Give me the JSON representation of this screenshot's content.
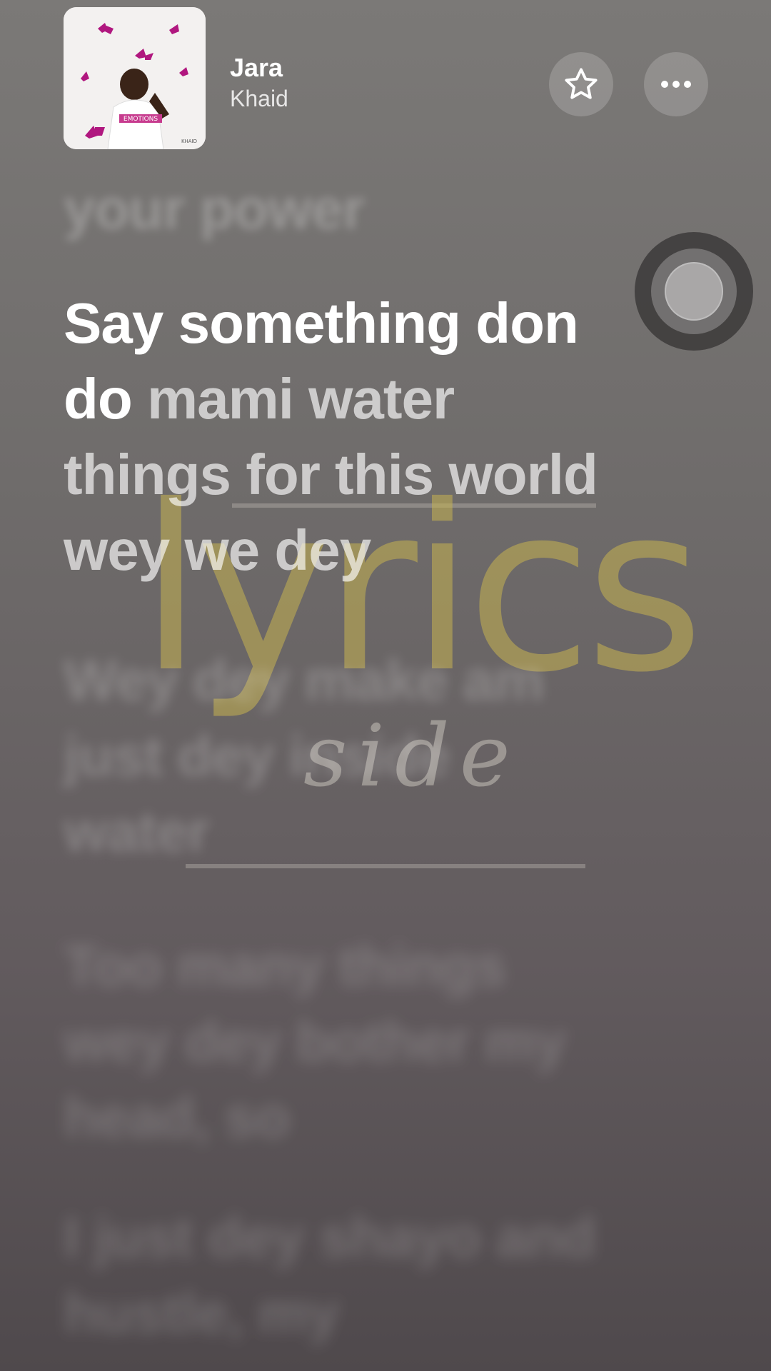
{
  "now_playing": {
    "title": "Jara",
    "artist": "Khaid",
    "album_art_text": "EMOTIONS",
    "album_art_credit": "KHAID",
    "favorite_icon": "star-outline-icon",
    "more_icon": "ellipsis-icon"
  },
  "lyrics": {
    "previous_line": "your power",
    "current": {
      "sung": "Say something don do",
      "unsung": "mami water things for this world wey we dey"
    },
    "upcoming": [
      "Wey dey make am just dey inside water",
      "Too many things wey dey bother my head, so",
      "I just dey shayo and hustle, my"
    ]
  },
  "watermark": {
    "word": "lyrics",
    "sub": "side"
  },
  "colors": {
    "watermark_gold": "#c6b250",
    "background_top": "#7b7977",
    "background_bottom": "#4f494c"
  }
}
